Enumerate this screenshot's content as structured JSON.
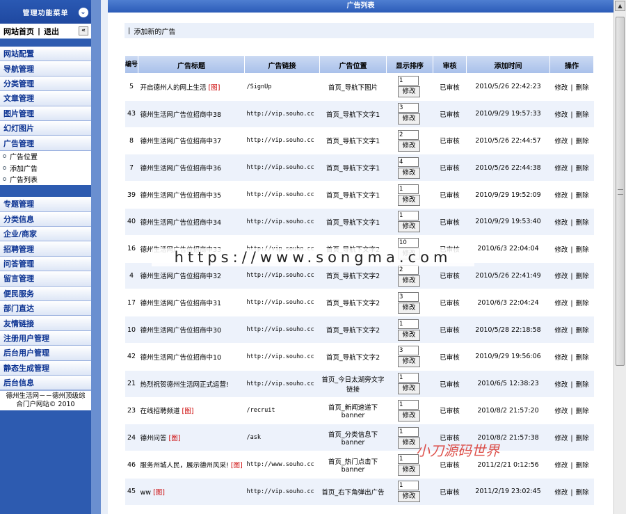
{
  "sidebar": {
    "header": "管理功能菜单",
    "toggle_icon": "⌄",
    "home": "网站首页",
    "home_sep": "|",
    "logout": "退出",
    "collapse_icon": "«",
    "group1": [
      {
        "label": "网站配置"
      },
      {
        "label": "导航管理"
      },
      {
        "label": "分类管理"
      },
      {
        "label": "文章管理"
      },
      {
        "label": "图片管理"
      },
      {
        "label": "幻灯图片"
      },
      {
        "label": "广告管理"
      }
    ],
    "subitems": [
      {
        "label": "广告位置"
      },
      {
        "label": "添加广告"
      },
      {
        "label": "广告列表"
      }
    ],
    "group2": [
      {
        "label": "专题管理"
      },
      {
        "label": "分类信息"
      },
      {
        "label": "企业/商家"
      },
      {
        "label": "招聘管理"
      },
      {
        "label": "问答管理"
      },
      {
        "label": "留言管理"
      },
      {
        "label": "便民服务"
      },
      {
        "label": "部门直达"
      },
      {
        "label": "友情链接"
      },
      {
        "label": "注册用户管理"
      },
      {
        "label": "后台用户管理"
      },
      {
        "label": "静态生成管理"
      },
      {
        "label": "后台信息"
      }
    ],
    "footer_line1": "德州生活网－－德州顶级综",
    "footer_line2": "合门户网站© 2010"
  },
  "main": {
    "title": "广告列表",
    "add_sep": "|",
    "add_link": "添加新的广告",
    "columns": {
      "id": "编号",
      "title": "广告标题",
      "link": "广告链接",
      "position": "广告位置",
      "sort": "显示排序",
      "audit": "审核",
      "time": "添加时间",
      "ops": "操作"
    },
    "img_tag": "[图]",
    "sort_button": "修改",
    "edit_label": "修改",
    "op_sep": "|",
    "delete_label": "删除",
    "rows": [
      {
        "id": "5",
        "title": "开启德州人的网上生活",
        "img": true,
        "link": "/SignUp",
        "position": "首页_导航下图片",
        "sort": "1",
        "audit": "已审核",
        "time": "2010/5/26 22:42:23"
      },
      {
        "id": "43",
        "title": "德州生活网广告位招商中38",
        "img": false,
        "link": "http://vip.souho.cc",
        "position": "首页_导航下文字1",
        "sort": "3",
        "audit": "已审核",
        "time": "2010/9/29 19:57:33"
      },
      {
        "id": "8",
        "title": "德州生活网广告位招商中37",
        "img": false,
        "link": "http://vip.souho.cc",
        "position": "首页_导航下文字1",
        "sort": "2",
        "audit": "已审核",
        "time": "2010/5/26 22:44:57"
      },
      {
        "id": "7",
        "title": "德州生活网广告位招商中36",
        "img": false,
        "link": "http://vip.souho.cc",
        "position": "首页_导航下文字1",
        "sort": "4",
        "audit": "已审核",
        "time": "2010/5/26 22:44:38"
      },
      {
        "id": "39",
        "title": "德州生活网广告位招商中35",
        "img": false,
        "link": "http://vip.souho.cc",
        "position": "首页_导航下文字1",
        "sort": "1",
        "audit": "已审核",
        "time": "2010/9/29 19:52:09"
      },
      {
        "id": "40",
        "title": "德州生活网广告位招商中34",
        "img": false,
        "link": "http://vip.souho.cc",
        "position": "首页_导航下文字1",
        "sort": "1",
        "audit": "已审核",
        "time": "2010/9/29 19:53:40"
      },
      {
        "id": "16",
        "title": "德州生活网广告位招商中33",
        "img": false,
        "link": "http://vip.souho.cc",
        "position": "首页_导航下文字2",
        "sort": "10",
        "audit": "已审核",
        "time": "2010/6/3 22:04:04"
      },
      {
        "id": "4",
        "title": "德州生活网广告位招商中32",
        "img": false,
        "link": "http://vip.souho.cc",
        "position": "首页_导航下文字2",
        "sort": "2",
        "audit": "已审核",
        "time": "2010/5/26 22:41:49"
      },
      {
        "id": "17",
        "title": "德州生活网广告位招商中31",
        "img": false,
        "link": "http://vip.souho.cc",
        "position": "首页_导航下文字2",
        "sort": "3",
        "audit": "已审核",
        "time": "2010/6/3 22:04:24"
      },
      {
        "id": "10",
        "title": "德州生活网广告位招商中30",
        "img": false,
        "link": "http://vip.souho.cc",
        "position": "首页_导航下文字2",
        "sort": "1",
        "audit": "已审核",
        "time": "2010/5/28 22:18:58"
      },
      {
        "id": "42",
        "title": "德州生活网广告位招商中10",
        "img": false,
        "link": "http://vip.souho.cc",
        "position": "首页_导航下文字2",
        "sort": "3",
        "audit": "已审核",
        "time": "2010/9/29 19:56:06"
      },
      {
        "id": "21",
        "title": "热烈祝贺德州生活网正式运营!",
        "img": false,
        "link": "http://vip.souho.cc",
        "position": "首页_今日太湖旁文字链接",
        "sort": "1",
        "audit": "已审核",
        "time": "2010/6/5 12:38:23"
      },
      {
        "id": "23",
        "title": "在线招聘频道",
        "img": true,
        "link": "/recruit",
        "position": "首页_新闻速递下banner",
        "sort": "1",
        "audit": "已审核",
        "time": "2010/8/2 21:57:20"
      },
      {
        "id": "24",
        "title": "德州问答",
        "img": true,
        "link": "/ask",
        "position": "首页_分类信息下banner",
        "sort": "1",
        "audit": "已审核",
        "time": "2010/8/2 21:57:38"
      },
      {
        "id": "46",
        "title": "服务州城人民，展示德州风采!",
        "img": true,
        "link": "http://www.souho.cc",
        "position": "首页_热门点击下banner",
        "sort": "1",
        "audit": "已审核",
        "time": "2011/2/21 0:12:56"
      },
      {
        "id": "45",
        "title": "ww",
        "img": true,
        "link": "http://vip.souho.cc",
        "position": "首页_右下角弹出广告",
        "sort": "1",
        "audit": "已审核",
        "time": "2011/2/19 23:02:45"
      }
    ]
  },
  "scrollbar": {
    "up_icon": "▲"
  },
  "watermark": "https://www.songma.com",
  "watermark2": "小刀源码世界"
}
